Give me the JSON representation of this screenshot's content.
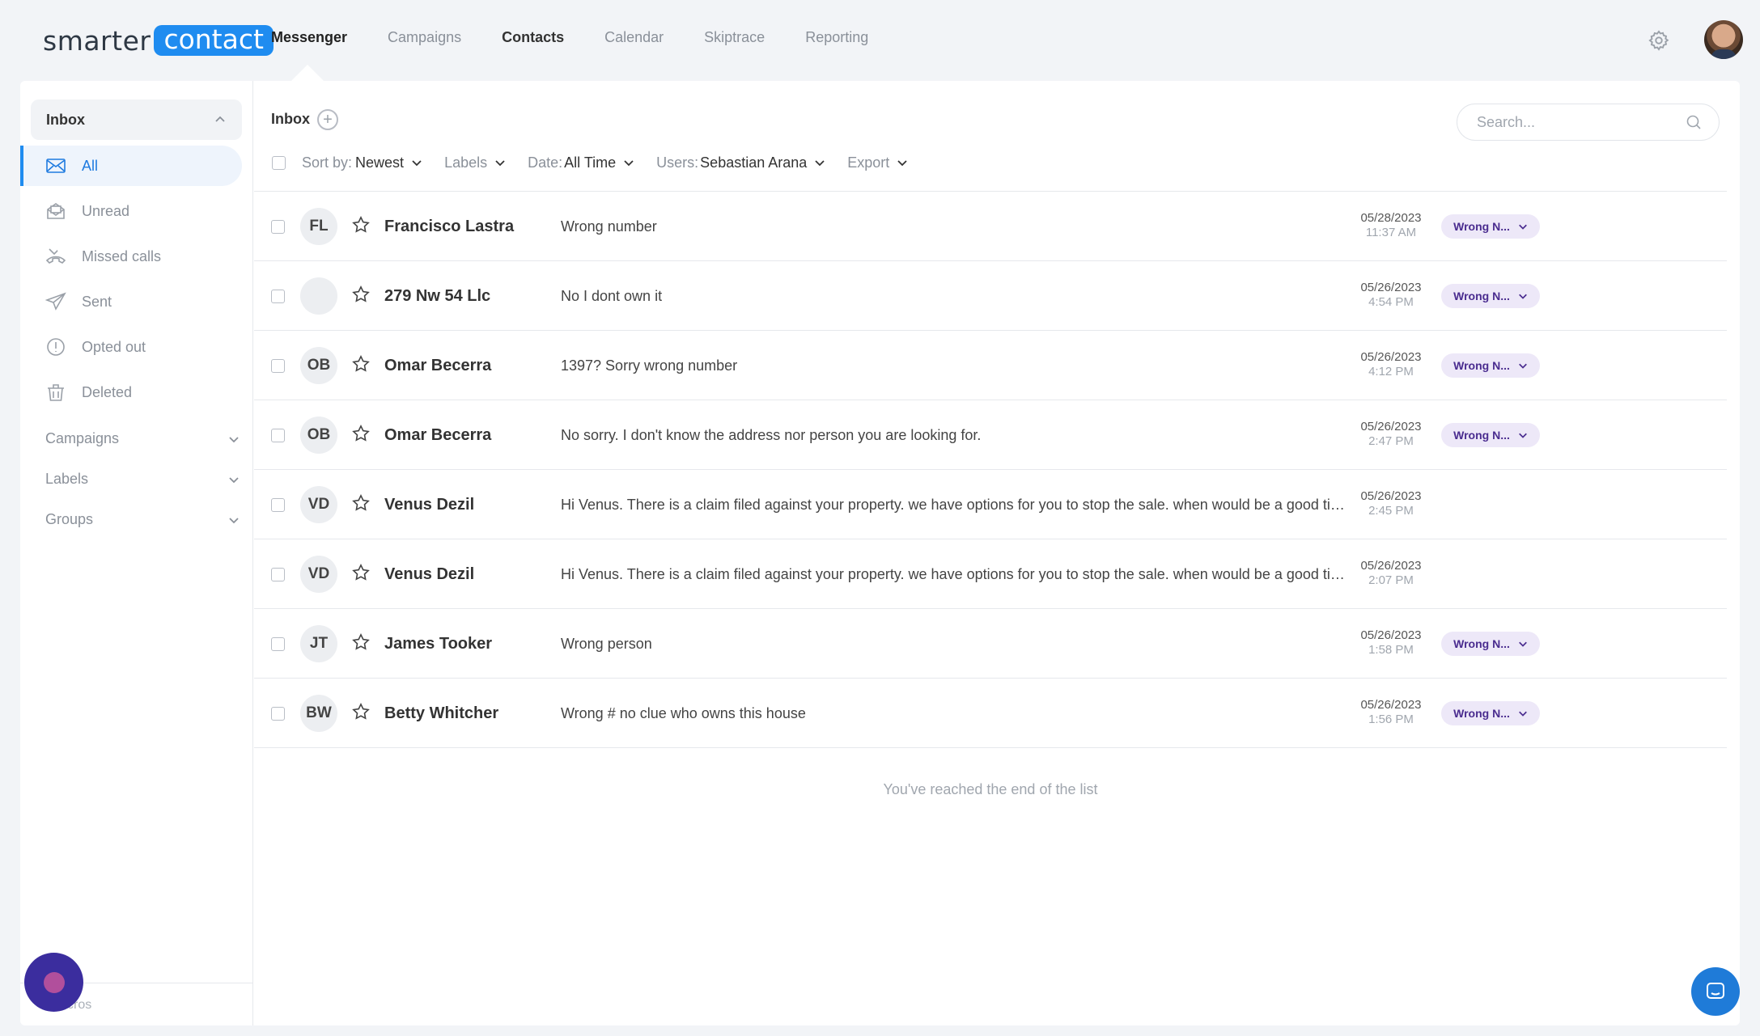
{
  "brand": {
    "part1": "smarter",
    "part2": "contact"
  },
  "nav": [
    {
      "label": "Messenger",
      "state": "active"
    },
    {
      "label": "Campaigns",
      "state": ""
    },
    {
      "label": "Contacts",
      "state": "bold"
    },
    {
      "label": "Calendar",
      "state": ""
    },
    {
      "label": "Skiptrace",
      "state": ""
    },
    {
      "label": "Reporting",
      "state": ""
    }
  ],
  "sidebar": {
    "inbox_label": "Inbox",
    "items": [
      {
        "label": "All",
        "icon": "mail-icon"
      },
      {
        "label": "Unread",
        "icon": "mail-open-icon"
      },
      {
        "label": "Missed calls",
        "icon": "missed-call-icon"
      },
      {
        "label": "Sent",
        "icon": "send-icon"
      },
      {
        "label": "Opted out",
        "icon": "alert-circle-icon"
      },
      {
        "label": "Deleted",
        "icon": "trash-icon"
      }
    ],
    "sections": [
      "Campaigns",
      "Labels",
      "Groups"
    ],
    "bottom_label": "cros"
  },
  "content": {
    "title": "Inbox",
    "search_placeholder": "Search...",
    "filters": {
      "sort_label": "Sort by:",
      "sort_value": "Newest",
      "labels_label": "Labels",
      "date_label": "Date:",
      "date_value": "All Time",
      "users_label": "Users:",
      "users_value": "Sebastian Arana",
      "export_label": "Export"
    },
    "rows": [
      {
        "initials": "FL",
        "name": "Francisco Lastra",
        "message": "Wrong number",
        "date": "05/28/2023",
        "time": "11:37 AM",
        "label": "Wrong N..."
      },
      {
        "initials": "",
        "name": "279 Nw 54 Llc",
        "message": "No I dont own it",
        "date": "05/26/2023",
        "time": "4:54 PM",
        "label": "Wrong N..."
      },
      {
        "initials": "OB",
        "name": "Omar Becerra",
        "message": "1397? Sorry wrong number",
        "date": "05/26/2023",
        "time": "4:12 PM",
        "label": "Wrong N..."
      },
      {
        "initials": "OB",
        "name": "Omar Becerra",
        "message": "No sorry. I don't know the address nor person you are looking for.",
        "date": "05/26/2023",
        "time": "2:47 PM",
        "label": "Wrong N..."
      },
      {
        "initials": "VD",
        "name": "Venus Dezil",
        "message": "Hi Venus. There is a claim filed against your property. we have options for you to stop the sale. when would be a good time to talk?",
        "date": "05/26/2023",
        "time": "2:45 PM",
        "label": ""
      },
      {
        "initials": "VD",
        "name": "Venus Dezil",
        "message": "Hi Venus. There is a claim filed against your property. we have options for you to stop the sale. when would be a good time to talk?",
        "date": "05/26/2023",
        "time": "2:07 PM",
        "label": ""
      },
      {
        "initials": "JT",
        "name": "James Tooker",
        "message": "Wrong person",
        "date": "05/26/2023",
        "time": "1:58 PM",
        "label": "Wrong N..."
      },
      {
        "initials": "BW",
        "name": "Betty Whitcher",
        "message": "Wrong # no clue who owns this house",
        "date": "05/26/2023",
        "time": "1:56 PM",
        "label": "Wrong N..."
      }
    ],
    "end_message": "You've reached the end of the list"
  },
  "colors": {
    "accent": "#1f8cf0",
    "label_bg": "#ede8f8",
    "label_text": "#4a2c8f"
  }
}
